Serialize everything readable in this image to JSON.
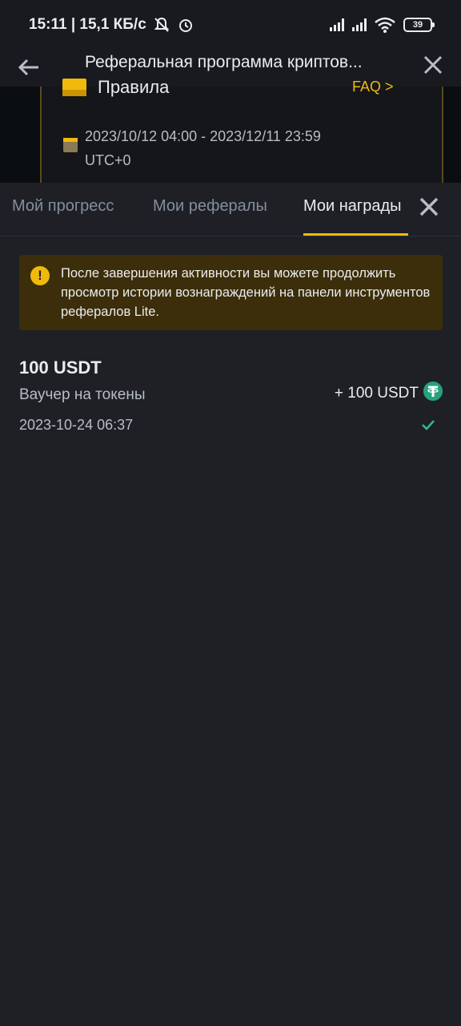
{
  "status_bar": {
    "time_speed": "15:11 | 15,1 КБ/с",
    "battery": "39"
  },
  "header": {
    "title": "Реферальная программа криптов..."
  },
  "event_card": {
    "rules_label": "Правила",
    "faq_label": "FAQ >",
    "date_range": "2023/10/12 04:00 - 2023/12/11 23:59",
    "timezone": "UTC+0"
  },
  "tabs": [
    {
      "label": "Мой прогресс"
    },
    {
      "label": "Мои рефералы"
    },
    {
      "label": "Мои награды"
    }
  ],
  "notice": {
    "text": "После завершения активности вы можете продолжить просмотр истории вознаграждений на панели инструментов рефералов Lite."
  },
  "reward": {
    "title": "100 USDT",
    "type": "Ваучер на токены",
    "amount": "+ 100 USDT",
    "date": "2023-10-24 06:37"
  },
  "colors": {
    "accent": "#f0b90b",
    "background": "#1e2026",
    "success": "#2ebd85"
  }
}
